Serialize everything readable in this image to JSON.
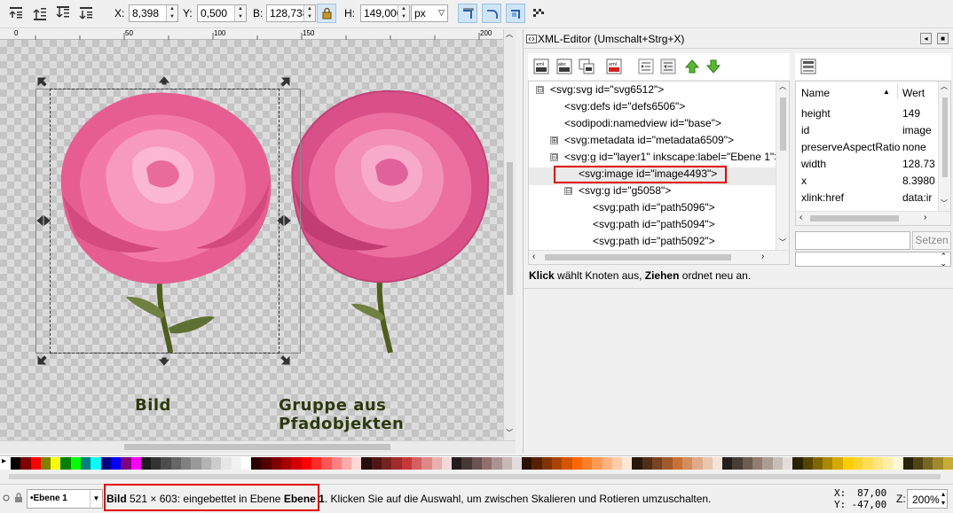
{
  "toolbar": {
    "x_label": "X:",
    "x_value": "8,398",
    "y_label": "Y:",
    "y_value": "0,500",
    "w_label": "B:",
    "w_value": "128,738",
    "h_label": "H:",
    "h_value": "149,000",
    "unit": "px",
    "icons": [
      "raise-to-top-icon",
      "raise-icon",
      "lower-icon",
      "lower-to-bottom-icon",
      "lock-proportions-icon",
      "scale-stroke-icon",
      "scale-corners-icon",
      "transform-gradients-icon",
      "transform-patterns-icon"
    ]
  },
  "ruler": {
    "ticks": [
      "0",
      "50",
      "100",
      "150",
      "200"
    ]
  },
  "canvas": {
    "label_left": "Bild",
    "label_right": "Gruppe aus Pfadobjekten"
  },
  "xml_editor": {
    "title": "XML-Editor (Umschalt+Strg+X)",
    "tree": [
      {
        "text": "<svg:svg id=\"svg6512\">",
        "expander": "⊟"
      },
      {
        "text": "<svg:defs id=\"defs6506\">",
        "expander": ""
      },
      {
        "text": "<sodipodi:namedview id=\"base\">",
        "expander": ""
      },
      {
        "text": "<svg:metadata id=\"metadata6509\">",
        "expander": "⊞"
      },
      {
        "text": "<svg:g id=\"layer1\" inkscape:label=\"Ebene 1\">",
        "expander": "⊟"
      },
      {
        "text": "<svg:image id=\"image4493\">",
        "expander": ""
      },
      {
        "text": "<svg:g id=\"g5058\">",
        "expander": "⊟"
      },
      {
        "text": "<svg:path id=\"path5096\">",
        "expander": ""
      },
      {
        "text": "<svg:path id=\"path5094\">",
        "expander": ""
      },
      {
        "text": "<svg:path id=\"path5092\">",
        "expander": ""
      }
    ],
    "attr_header_name": "Name",
    "attr_header_value": "Wert",
    "attributes": [
      {
        "name": "height",
        "value": "149"
      },
      {
        "name": "id",
        "value": "image"
      },
      {
        "name": "preserveAspectRatio",
        "value": "none"
      },
      {
        "name": "width",
        "value": "128.73"
      },
      {
        "name": "x",
        "value": "8.3980"
      },
      {
        "name": "xlink:href",
        "value": "data:ir"
      }
    ],
    "set_button": "Setzen",
    "hint_bold1": "Klick",
    "hint_text1": " wählt Knoten aus, ",
    "hint_bold2": "Ziehen",
    "hint_text2": " ordnet neu an."
  },
  "palette": {
    "colors": [
      "#000000",
      "#800000",
      "#ff0000",
      "#808000",
      "#ffff00",
      "#008000",
      "#00ff00",
      "#008080",
      "#00ffff",
      "#000080",
      "#0000ff",
      "#800080",
      "#ff00ff",
      "#1a1a1a",
      "#333333",
      "#4d4d4d",
      "#666666",
      "#808080",
      "#999999",
      "#b3b3b3",
      "#cccccc",
      "#e6e6e6",
      "#f2f2f2",
      "#ffffff",
      "#2b0000",
      "#550000",
      "#800000",
      "#aa0000",
      "#d40000",
      "#ff0000",
      "#ff2a2a",
      "#ff5555",
      "#ff8080",
      "#ffaaaa",
      "#ffd5d5",
      "#280b0b",
      "#501616",
      "#782121",
      "#a02c2c",
      "#c83737",
      "#d35f5f",
      "#de8787",
      "#e9afaf",
      "#f4d7d7",
      "#241c1c",
      "#483737",
      "#6c5353",
      "#916f6f",
      "#ac9393",
      "#c8b7b7",
      "#e3dbdb",
      "#2b1100",
      "#552200",
      "#803300",
      "#aa4400",
      "#d45500",
      "#ff6600",
      "#ff7f2a",
      "#ff9955",
      "#ffb380",
      "#ffccaa",
      "#ffe6d5",
      "#28170b",
      "#502d16",
      "#784421",
      "#a05a2c",
      "#c87137",
      "#d38d5f",
      "#deaa87",
      "#e9c6af",
      "#f4e3d7",
      "#241f1c",
      "#483e37",
      "#6c5d53",
      "#917c6f",
      "#ac9d93",
      "#c8beb7",
      "#e3dedb",
      "#2b2200",
      "#554400",
      "#806600",
      "#aa8800",
      "#d4aa00",
      "#ffcc00",
      "#ffd42a",
      "#ffdd55",
      "#ffe680",
      "#ffeeaa",
      "#fff6d5",
      "#28220b",
      "#504416",
      "#786721",
      "#a0892c",
      "#c8ab37"
    ]
  },
  "status": {
    "layer": "•Ebene 1",
    "msg_bold": "Bild",
    "msg_text1": " 521 × 603: eingebettet in Ebene ",
    "msg_layer": "Ebene 1",
    "msg_text2": ". Klicken Sie auf die Auswahl, um zwischen Skalieren und Rotieren umzuschalten.",
    "coord_x_label": "X:",
    "coord_x": "87,00",
    "coord_y_label": "Y:",
    "coord_y": "-47,00",
    "zoom_label": "Z:",
    "zoom": "200%"
  }
}
